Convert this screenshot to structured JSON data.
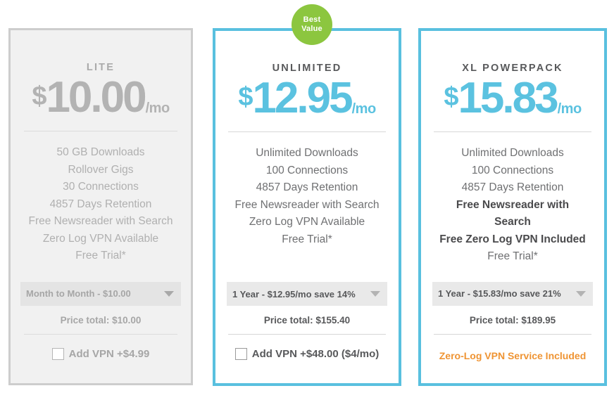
{
  "badge": {
    "line1": "Best",
    "line2": "Value"
  },
  "colors": {
    "accent_blue": "#5bc2e0",
    "badge_green": "#8cc63f",
    "orange": "#ef9433",
    "muted_gray": "#b3b3b3",
    "text_dark": "#58595b"
  },
  "plans": [
    {
      "id": "lite",
      "name": "LITE",
      "currency": "$",
      "amount": "10.00",
      "period": "/mo",
      "features": [
        {
          "text": "50 GB Downloads",
          "bold": false
        },
        {
          "text": "Rollover Gigs",
          "bold": false
        },
        {
          "text": "30 Connections",
          "bold": false
        },
        {
          "text": "4857 Days Retention",
          "bold": false
        },
        {
          "text": "Free Newsreader with Search",
          "bold": false
        },
        {
          "text": "Zero Log VPN Available",
          "bold": false
        },
        {
          "text": "Free Trial*",
          "bold": false
        }
      ],
      "term_selected": "Month to Month - $10.00",
      "price_total": "Price total: $10.00",
      "vpn_label": "Add VPN +$4.99",
      "vpn_checked": false
    },
    {
      "id": "unlimited",
      "name": "UNLIMITED",
      "currency": "$",
      "amount": "12.95",
      "period": "/mo",
      "features": [
        {
          "text": "Unlimited Downloads",
          "bold": false
        },
        {
          "text": "100 Connections",
          "bold": false
        },
        {
          "text": "4857 Days Retention",
          "bold": false
        },
        {
          "text": "Free Newsreader with Search",
          "bold": false
        },
        {
          "text": "Zero Log VPN Available",
          "bold": false
        },
        {
          "text": "Free Trial*",
          "bold": false
        }
      ],
      "term_selected": "1 Year - $12.95/mo save 14%",
      "price_total": "Price total: $155.40",
      "vpn_label": "Add VPN +$48.00 ($4/mo)",
      "vpn_checked": false
    },
    {
      "id": "xl",
      "name": "XL POWERPACK",
      "currency": "$",
      "amount": "15.83",
      "period": "/mo",
      "features": [
        {
          "text": "Unlimited Downloads",
          "bold": false
        },
        {
          "text": "100 Connections",
          "bold": false
        },
        {
          "text": "4857 Days Retention",
          "bold": false
        },
        {
          "text": "Free Newsreader with Search",
          "bold": true
        },
        {
          "text": "Free Zero Log VPN Included",
          "bold": true
        },
        {
          "text": "Free Trial*",
          "bold": false
        }
      ],
      "term_selected": "1 Year - $15.83/mo save 21%",
      "price_total": "Price total: $189.95",
      "vpn_included_note": "Zero-Log VPN Service Included"
    }
  ]
}
